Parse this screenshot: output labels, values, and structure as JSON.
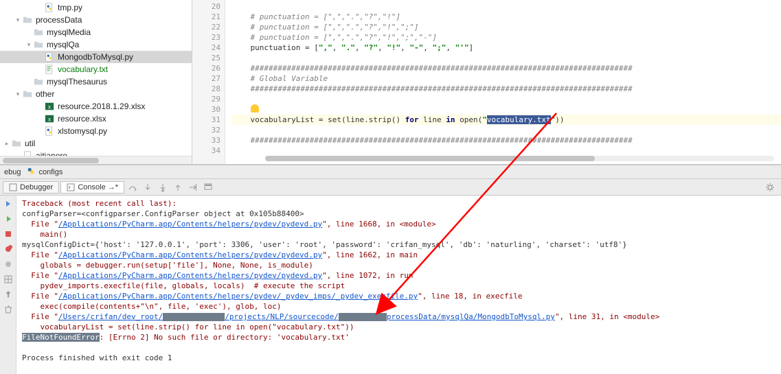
{
  "tree": {
    "item0": "tmp.py",
    "item1": "processData",
    "item2": "mysqlMedia",
    "item3": "mysqlQa",
    "item4": "MongodbToMysql.py",
    "item5": "vocabulary.txt",
    "item6": "mysqlThesaurus",
    "item7": "other",
    "item8": "resource.2018.1.29.xlsx",
    "item9": "resource.xlsx",
    "item10": "xlstomysql.py",
    "item11": "util",
    "item12": "aitianoro"
  },
  "gutter": [
    "20",
    "21",
    "22",
    "23",
    "24",
    "25",
    "26",
    "27",
    "28",
    "29",
    "30",
    "31",
    "32",
    "33",
    "34"
  ],
  "code": {
    "c21": "# punctuation = [\",\",\".\",\"?\",\"!\"]",
    "c22": "# punctuation = [\",\",\".\",\"?\",\"!\",\";\"]",
    "c23": "# punctuation = [\",\",\".\",\"?\",\"!\",\";\",\"-\"]",
    "c24a": "punctuation = [",
    "c24b": "\",\"",
    "c24c": ", ",
    "c24d": "\".\"",
    "c24e": "\"?\"",
    "c24f": "\"!\"",
    "c24g": "\"-\"",
    "c24h": "\";\"",
    "c24i": "\"'\"",
    "c24z": "]",
    "c26": "####################################################################################",
    "c27": "# Global Variable",
    "c28": "####################################################################################",
    "c31a": "vocabularyList = set(line.strip() ",
    "c31for": "for",
    "c31b": " line ",
    "c31in": "in",
    "c31c": " open(",
    "c31q": "\"",
    "c31sel": "vocabulary.txt",
    "c31q2": "\"",
    "c31d": "))",
    "c33": "####################################################################################"
  },
  "toolstrip": {
    "label": "ebug",
    "config": "configs"
  },
  "dbg": {
    "tab1": "Debugger",
    "tab2": "Console →*"
  },
  "console": {
    "l1": "Traceback (most recent call last):",
    "l2": "configParser=<configparser.ConfigParser object at 0x105b88400>",
    "l3a": "  File \"",
    "l3b": "/Applications/PyCharm.app/Contents/helpers/pydev/pydevd.py",
    "l3c": "\", line 1668, in <module>",
    "l4": "    main()",
    "l5": "mysqlConfigDict={'host': '127.0.0.1', 'port': 3306, 'user': 'root', 'password': 'crifan_mysql', 'db': 'naturling', 'charset': 'utf8'}",
    "l6a": "  File \"",
    "l6b": "/Applications/PyCharm.app/Contents/helpers/pydev/pydevd.py",
    "l6c": "\", line 1662, in main",
    "l7": "    globals = debugger.run(setup['file'], None, None, is_module)",
    "l8a": "  File \"",
    "l8b": "/Applications/PyCharm.app/Contents/helpers/pydev/pydevd.py",
    "l8c": "\", line 1072, in run",
    "l9": "    pydev_imports.execfile(file, globals, locals)  # execute the script",
    "l10a": "  File \"",
    "l10b": "/Applications/PyCharm.app/Contents/helpers/pydev/_pydev_imps/_pydev_execfile.py",
    "l10c": "\", line 18, in execfile",
    "l11": "    exec(compile(contents+\"\\n\", file, 'exec'), glob, loc)",
    "l12a": "  File \"",
    "l12b": "/Users/crifan/dev_root/",
    "l12d": "/projects/NLP/sourcecode/",
    "l12f": "processData/mysqlQa/MongodbToMysql.py",
    "l12g": "\", line 31, in <module>",
    "l13": "    vocabularyList = set(line.strip() for line in open(\"vocabulary.txt\"))",
    "l14a": "FileNotFoundError",
    "l14b": ": [Errno 2] No such file or directory: 'vocabulary.txt'",
    "l16": "Process finished with exit code 1"
  }
}
